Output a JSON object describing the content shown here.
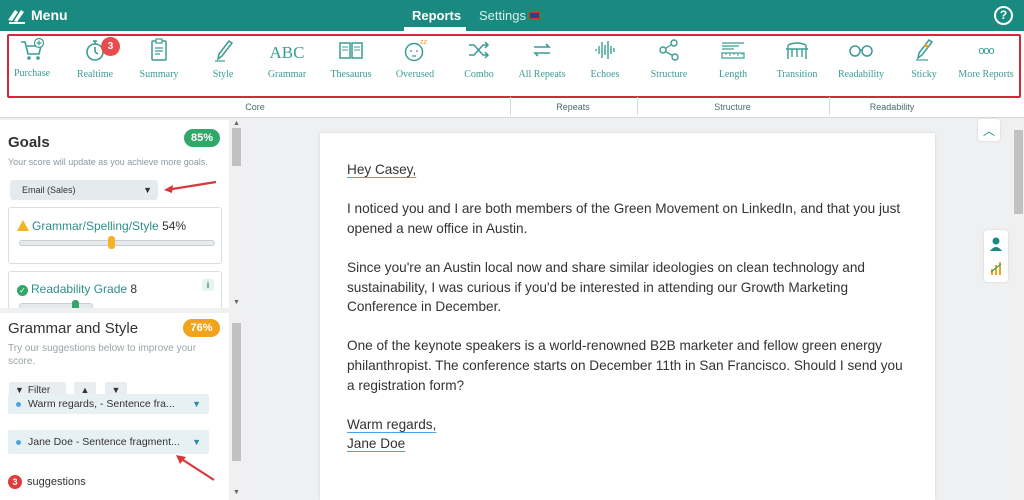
{
  "topbar": {
    "menu_label": "Menu",
    "tabs": [
      {
        "label": "Reports",
        "active": true
      },
      {
        "label": "Settings",
        "active": false
      }
    ],
    "help_glyph": "?"
  },
  "toolbar": {
    "tools": [
      {
        "label": "Purchase",
        "icon": "cart-icon"
      },
      {
        "label": "Realtime",
        "icon": "stopwatch-icon",
        "badge": "3"
      },
      {
        "label": "Summary",
        "icon": "clipboard-icon"
      },
      {
        "label": "Style",
        "icon": "pencil-icon"
      },
      {
        "label": "Grammar",
        "icon": "abc-icon",
        "glyph": "ABC"
      },
      {
        "label": "Thesaurus",
        "icon": "book-icon"
      },
      {
        "label": "Overused",
        "icon": "sleepy-face-icon"
      },
      {
        "label": "Combo",
        "icon": "shuffle-icon"
      },
      {
        "label": "All Repeats",
        "icon": "repeat-icon"
      },
      {
        "label": "Echoes",
        "icon": "soundwave-icon"
      },
      {
        "label": "Structure",
        "icon": "network-icon"
      },
      {
        "label": "Length",
        "icon": "ruler-icon"
      },
      {
        "label": "Transition",
        "icon": "bridge-icon"
      },
      {
        "label": "Readability",
        "icon": "glasses-icon"
      },
      {
        "label": "Sticky",
        "icon": "sticky-pen-icon"
      },
      {
        "label": "More Reports",
        "icon": "more-icon",
        "glyph": "ooo"
      }
    ],
    "groups": [
      "Core",
      "Repeats",
      "Structure",
      "Readability"
    ]
  },
  "goals": {
    "title": "Goals",
    "score": "85%",
    "subtitle": "Your score will update as you achieve more goals.",
    "goal_type": "Email (Sales)",
    "metrics": [
      {
        "label": "Grammar/Spelling/Style",
        "value": "54%",
        "level": 0.47
      },
      {
        "label": "Readability Grade",
        "value": "8",
        "level": 0.75,
        "info": "i"
      }
    ]
  },
  "grammar": {
    "title": "Grammar and Style",
    "score": "76%",
    "subtitle": "Try our suggestions below to improve your score.",
    "filter_label": "Filter",
    "up_glyph": "▲",
    "down_glyph": "▼",
    "suggestions": [
      {
        "text": "Warm regards,  -  Sentence fra..."
      },
      {
        "text": "Jane Doe  -  Sentence fragment..."
      }
    ],
    "count": "3",
    "count_label": "suggestions"
  },
  "document": {
    "greeting": "Hey Casey,",
    "paragraphs": [
      "I noticed you and I are both members of the Green Movement on LinkedIn, and that you just opened a new office in Austin.",
      "Since you're an Austin local now and share similar ideologies on clean technology and sustainability, I was curious if you'd be interested in attending our Growth Marketing Conference in December.",
      "One of the keynote speakers is a world-renowned B2B marketer and fellow green energy philanthropist. The conference starts on December 11th in San Francisco. Should I send you a registration form?"
    ],
    "closing": "Warm regards,",
    "signature": "Jane Doe"
  },
  "colors": {
    "brand": "#1a8a80",
    "tool_text": "#3b9c93",
    "highlight_border": "#d12a3a",
    "score_green": "#2fa86a",
    "score_orange": "#f2a31c",
    "annotation_arrow": "#d9373b"
  }
}
